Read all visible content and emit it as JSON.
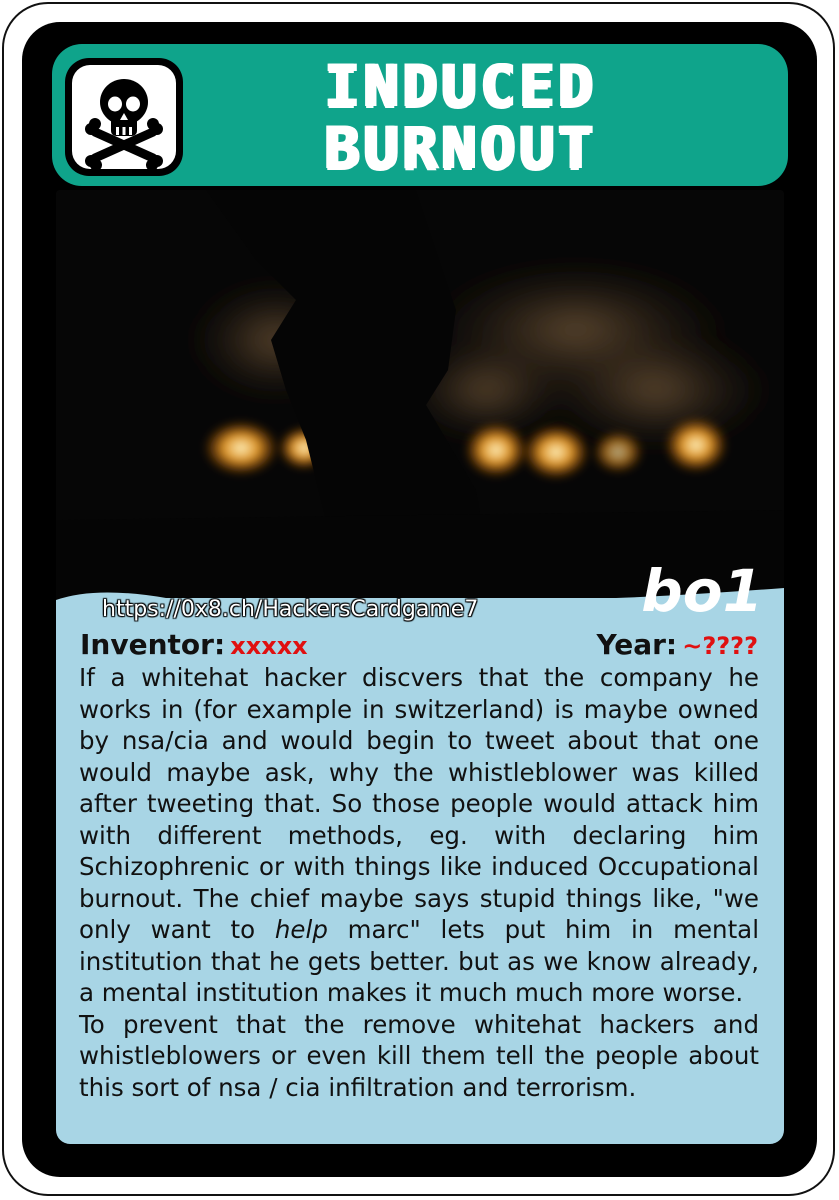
{
  "card": {
    "title_line1": "INDUCED",
    "title_line2": "BURNOUT",
    "icon": "skull-crossbones-icon",
    "accent_color": "#0fa48b",
    "panel_color": "#a8d5e5",
    "card_id": "bo1",
    "url": "https://0x8.ch/HackersCardgame7"
  },
  "meta": {
    "inventor_label": "Inventor:",
    "inventor_value": "xxxxx",
    "year_label": "Year:",
    "year_value": "~????"
  },
  "description": {
    "p1_before": "If a whitehat hacker discvers that the company he works in (for example in switzerland) is maybe owned by nsa/cia and would begin to tweet about that one would maybe ask, why the whistleblower was killed after tweeting that. So those people would attack him with different methods, eg. with declaring him Schizophrenic or with things like induced Occupational burnout. The chief maybe says stupid things like, \"we only want to ",
    "p1_emphasis": "help",
    "p1_after": " marc\" lets put him in mental institution that he gets better. but as we know already, a mental institution makes it much much more worse.",
    "p2": "To prevent that the remove whitehat hackers and whistleblowers or even kill them tell the people about this sort of nsa / cia infiltration and terrorism."
  }
}
